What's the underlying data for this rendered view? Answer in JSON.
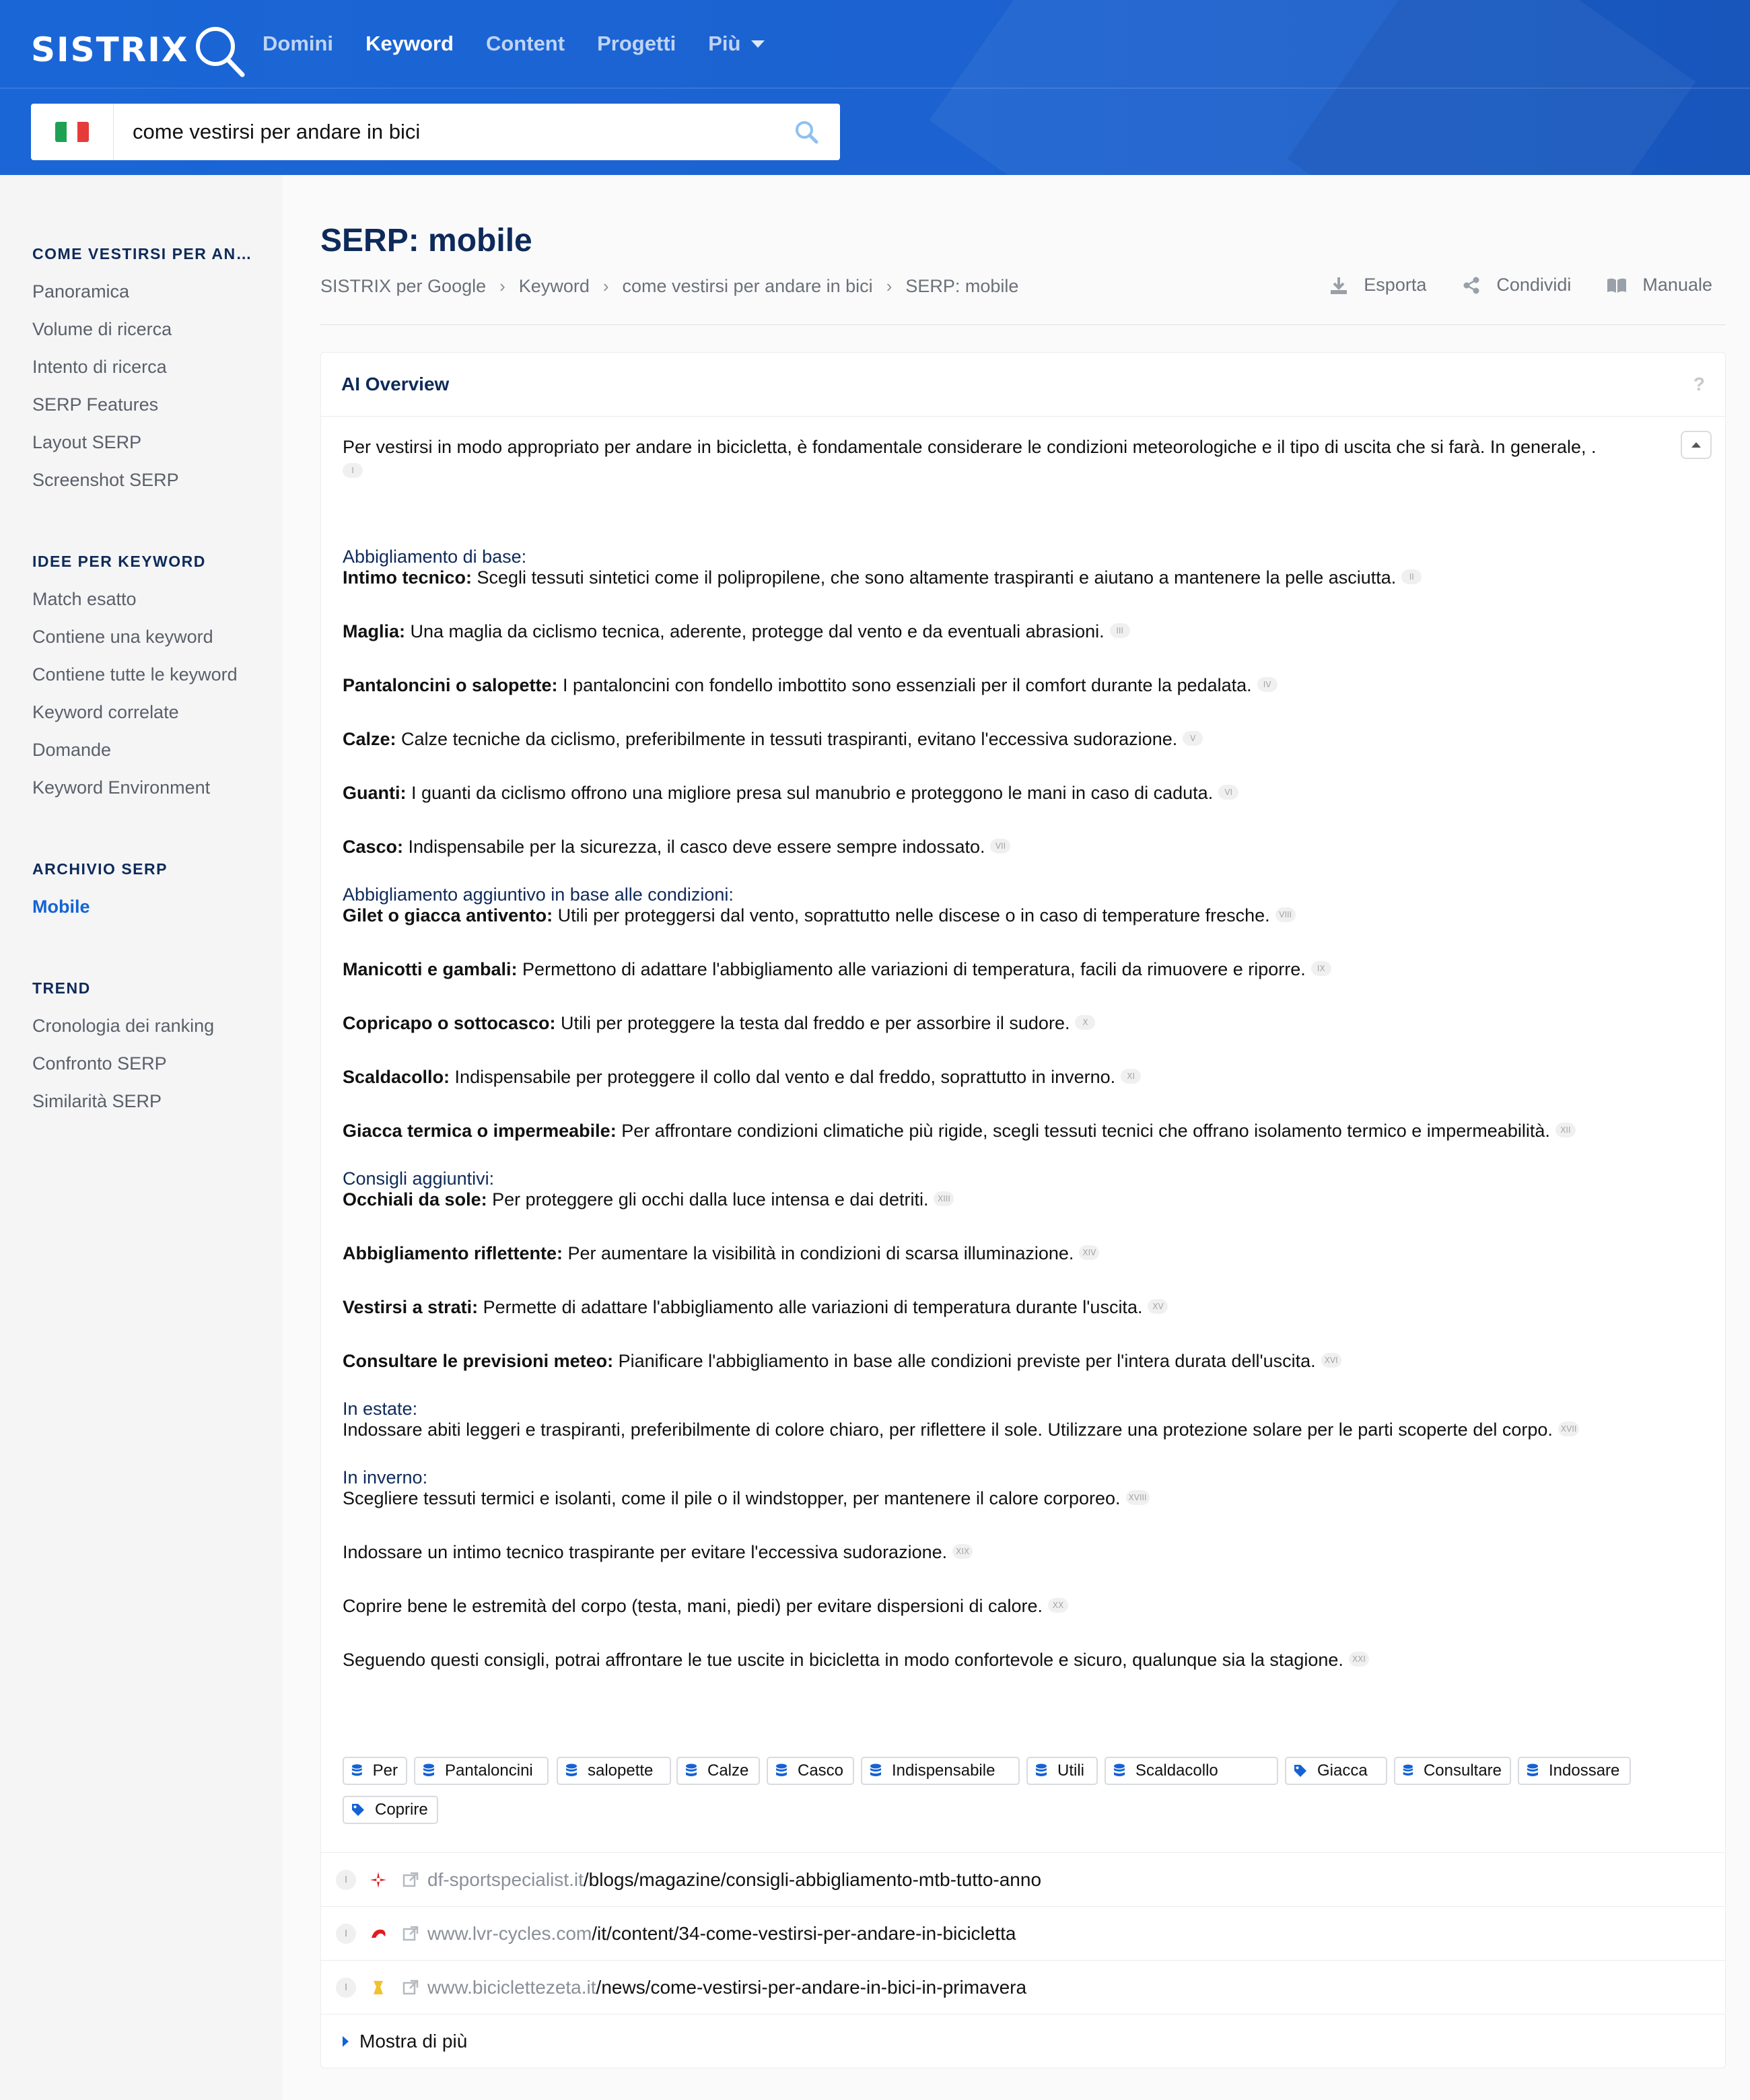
{
  "header": {
    "logo": "SISTRIX",
    "nav": [
      {
        "label": "Domini"
      },
      {
        "label": "Keyword",
        "active": true
      },
      {
        "label": "Content"
      },
      {
        "label": "Progetti"
      },
      {
        "label": "Più",
        "dropdown": true
      }
    ],
    "search": {
      "country": "Italy",
      "value": "come vestirsi per andare in bici"
    },
    "colors": {
      "primary": "#1a66d6",
      "accent": "#1463d4",
      "heading": "#0e2a5a"
    }
  },
  "sidebar": {
    "sections": [
      {
        "title": "COME VESTIRSI PER AN…",
        "items": [
          "Panoramica",
          "Volume di ricerca",
          "Intento di ricerca",
          "SERP Features",
          "Layout SERP",
          "Screenshot SERP"
        ]
      },
      {
        "title": "IDEE PER KEYWORD",
        "items": [
          "Match esatto",
          "Contiene una keyword",
          "Contiene tutte le keyword",
          "Keyword correlate",
          "Domande",
          "Keyword Environment"
        ]
      },
      {
        "title": "ARCHIVIO SERP",
        "items": [
          "Mobile"
        ],
        "active": "Mobile"
      },
      {
        "title": "TREND",
        "items": [
          "Cronologia dei ranking",
          "Confronto SERP",
          "Similarità SERP"
        ]
      }
    ]
  },
  "page": {
    "title": "SERP: mobile",
    "breadcrumb": [
      "SISTRIX per Google",
      "Keyword",
      "come vestirsi per andare in bici",
      "SERP: mobile"
    ],
    "actions": {
      "export": "Esporta",
      "share": "Condividi",
      "manual": "Manuale"
    }
  },
  "ai_overview": {
    "title": "AI Overview",
    "help": "?",
    "intro": "Per vestirsi in modo appropriato per andare in bicicletta, è fondamentale considerare le condizioni meteorologiche e il tipo di uscita che si farà. In generale, .",
    "intro_cite": "I",
    "lines": [
      {
        "type": "heading",
        "text": "Abbigliamento di base:"
      },
      {
        "type": "item",
        "bold": "Intimo tecnico:",
        "text": " Scegli tessuti sintetici come il polipropilene, che sono altamente traspiranti e aiutano a mantenere la pelle asciutta.",
        "cite": "II"
      },
      {
        "type": "item",
        "bold": "Maglia:",
        "text": " Una maglia da ciclismo tecnica, aderente, protegge dal vento e da eventuali abrasioni.",
        "cite": "III"
      },
      {
        "type": "item",
        "bold": "Pantaloncini o salopette:",
        "text": " I pantaloncini con fondello imbottito sono essenziali per il comfort durante la pedalata.",
        "cite": "IV"
      },
      {
        "type": "item",
        "bold": "Calze:",
        "text": " Calze tecniche da ciclismo, preferibilmente in tessuti traspiranti, evitano l'eccessiva sudorazione.",
        "cite": "V"
      },
      {
        "type": "item",
        "bold": "Guanti:",
        "text": " I guanti da ciclismo offrono una migliore presa sul manubrio e proteggono le mani in caso di caduta.",
        "cite": "VI"
      },
      {
        "type": "item",
        "bold": "Casco:",
        "text": " Indispensabile per la sicurezza, il casco deve essere sempre indossato.",
        "cite": "VII"
      },
      {
        "type": "heading",
        "text": "Abbigliamento aggiuntivo in base alle condizioni:"
      },
      {
        "type": "item",
        "bold": "Gilet o giacca antivento:",
        "text": " Utili per proteggersi dal vento, soprattutto nelle discese o in caso di temperature fresche.",
        "cite": "VIII"
      },
      {
        "type": "item",
        "bold": "Manicotti e gambali:",
        "text": " Permettono di adattare l'abbigliamento alle variazioni di temperatura, facili da rimuovere e riporre.",
        "cite": "IX"
      },
      {
        "type": "item",
        "bold": "Copricapo o sottocasco:",
        "text": " Utili per proteggere la testa dal freddo e per assorbire il sudore.",
        "cite": "X"
      },
      {
        "type": "item",
        "bold": "Scaldacollo:",
        "text": " Indispensabile per proteggere il collo dal vento e dal freddo, soprattutto in inverno.",
        "cite": "XI"
      },
      {
        "type": "item",
        "bold": "Giacca termica o impermeabile:",
        "text": " Per affrontare condizioni climatiche più rigide, scegli tessuti tecnici che offrano isolamento termico e impermeabilità.",
        "cite": "XII"
      },
      {
        "type": "heading",
        "text": "Consigli aggiuntivi:"
      },
      {
        "type": "item",
        "bold": "Occhiali da sole:",
        "text": " Per proteggere gli occhi dalla luce intensa e dai detriti.",
        "cite": "XIII"
      },
      {
        "type": "item",
        "bold": "Abbigliamento riflettente:",
        "text": " Per aumentare la visibilità in condizioni di scarsa illuminazione.",
        "cite": "XIV"
      },
      {
        "type": "item",
        "bold": "Vestirsi a strati:",
        "text": " Permette di adattare l'abbigliamento alle variazioni di temperatura durante l'uscita.",
        "cite": "XV"
      },
      {
        "type": "item",
        "bold": "Consultare le previsioni meteo:",
        "text": " Pianificare l'abbigliamento in base alle condizioni previste per l'intera durata dell'uscita.",
        "cite": "XVI"
      },
      {
        "type": "heading",
        "text": "In estate:"
      },
      {
        "type": "item",
        "bold": "",
        "text": "Indossare abiti leggeri e traspiranti, preferibilmente di colore chiaro, per riflettere il sole. Utilizzare una protezione solare per le parti scoperte del corpo.",
        "cite": "XVII"
      },
      {
        "type": "heading",
        "text": "In inverno:"
      },
      {
        "type": "item",
        "bold": "",
        "text": "Scegliere tessuti termici e isolanti, come il pile o il windstopper, per mantenere il calore corporeo.",
        "cite": "XVIII"
      },
      {
        "type": "item",
        "bold": "",
        "text": "Indossare un intimo tecnico traspirante per evitare l'eccessiva sudorazione.",
        "cite": "XIX"
      },
      {
        "type": "item",
        "bold": "",
        "text": "Coprire bene le estremità del corpo (testa, mani, piedi) per evitare dispersioni di calore.",
        "cite": "XX"
      },
      {
        "type": "item",
        "bold": "",
        "text": "Seguendo questi consigli, potrai affrontare le tue uscite in bicicletta in modo confortevole e sicuro, qualunque sia la stagione.",
        "cite": "XXI"
      }
    ],
    "chips": [
      {
        "label": "Per",
        "icon": "database-icon"
      },
      {
        "label": "Pantaloncini",
        "icon": "database-icon"
      },
      {
        "label": "salopette",
        "icon": "database-icon"
      },
      {
        "label": "Calze",
        "icon": "database-icon"
      },
      {
        "label": "Casco",
        "icon": "database-icon"
      },
      {
        "label": "Indispensabile",
        "icon": "database-icon"
      },
      {
        "label": "Utili",
        "icon": "database-icon"
      },
      {
        "label": "Scaldacollo",
        "icon": "database-icon"
      },
      {
        "label": "Giacca",
        "icon": "tag-icon"
      },
      {
        "label": "Consultare",
        "icon": "database-icon"
      },
      {
        "label": "Indossare",
        "icon": "database-icon"
      },
      {
        "label": "Coprire",
        "icon": "tag-icon"
      }
    ],
    "sources": [
      {
        "index": "I",
        "domain": "df-sportspecialist.it",
        "path": "/blogs/magazine/consigli-abbigliamento-mtb-tutto-anno",
        "favicon": "df-favicon"
      },
      {
        "index": "I",
        "domain": "www.lvr-cycles.com",
        "path": "/it/content/34-come-vestirsi-per-andare-in-bicicletta",
        "favicon": "lvr-favicon"
      },
      {
        "index": "I",
        "domain": "www.biciclettezeta.it",
        "path": "/news/come-vestirsi-per-andare-in-bici-in-primavera",
        "favicon": "zeta-favicon"
      }
    ],
    "show_more": "Mostra di più"
  }
}
